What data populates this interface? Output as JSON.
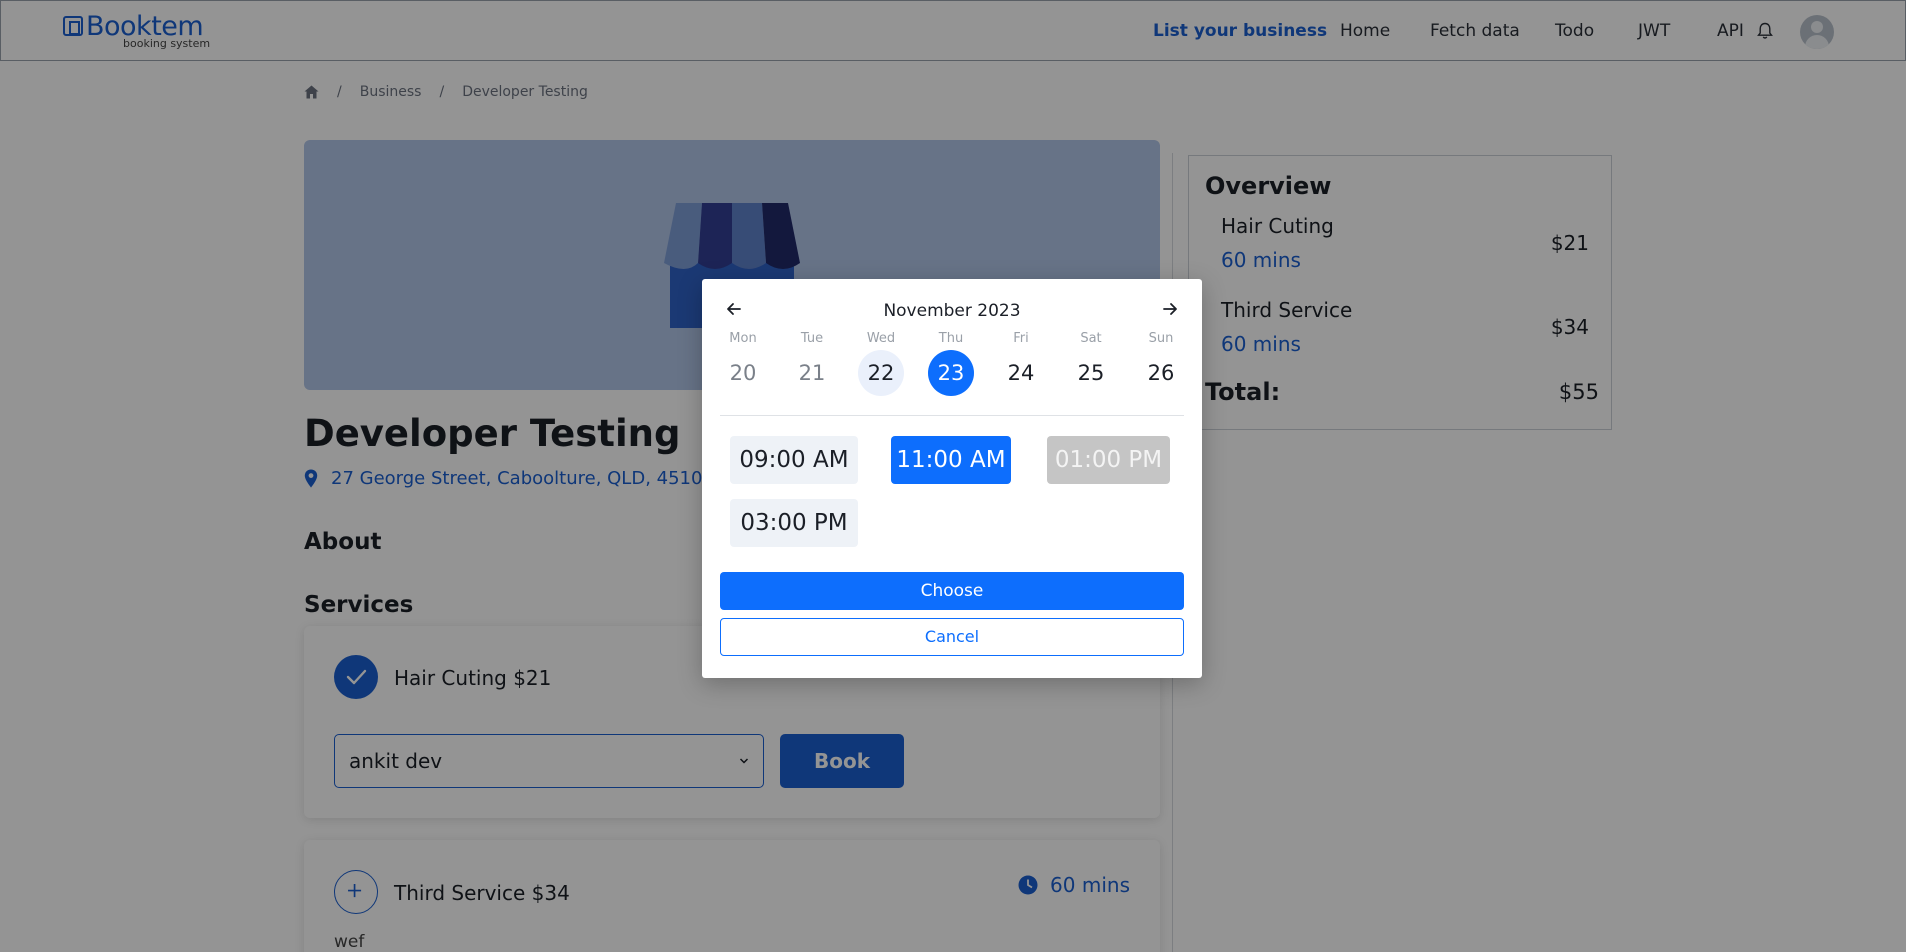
{
  "brand": {
    "name": "Booktem",
    "tagline": "booking system",
    "color": "#1a5fd1"
  },
  "nav": {
    "items": [
      "List your business",
      "Home",
      "Fetch data",
      "Todo",
      "JWT",
      "API"
    ]
  },
  "breadcrumb": [
    "Business",
    "Developer Testing"
  ],
  "business": {
    "title": "Developer Testing",
    "address": "27 George Street, Caboolture, QLD, 4510",
    "about_heading": "About",
    "services_heading": "Services"
  },
  "services": [
    {
      "label": "Hair Cuting $21",
      "staff": "ankit dev",
      "book_label": "Book",
      "selected": true
    },
    {
      "label": "Third Service $34",
      "duration": "60 mins",
      "description": "wef",
      "selected": false
    }
  ],
  "overview": {
    "title": "Overview",
    "items": [
      {
        "name": "Hair Cuting",
        "duration": "60 mins",
        "price": "$21"
      },
      {
        "name": "Third Service",
        "duration": "60 mins",
        "price": "$34"
      }
    ],
    "total_label": "Total:",
    "total_value": "$55"
  },
  "datepicker": {
    "month": "November 2023",
    "days": [
      {
        "dow": "Mon",
        "num": "20",
        "state": "past"
      },
      {
        "dow": "Tue",
        "num": "21",
        "state": "past"
      },
      {
        "dow": "Wed",
        "num": "22",
        "state": "today"
      },
      {
        "dow": "Thu",
        "num": "23",
        "state": "selected"
      },
      {
        "dow": "Fri",
        "num": "24",
        "state": "normal"
      },
      {
        "dow": "Sat",
        "num": "25",
        "state": "normal"
      },
      {
        "dow": "Sun",
        "num": "26",
        "state": "normal"
      }
    ],
    "slots": [
      {
        "time": "09:00 AM",
        "state": "available"
      },
      {
        "time": "11:00 AM",
        "state": "selected"
      },
      {
        "time": "01:00 PM",
        "state": "disabled"
      },
      {
        "time": "03:00 PM",
        "state": "available"
      }
    ],
    "choose_label": "Choose",
    "cancel_label": "Cancel"
  },
  "colors": {
    "primary": "#0d6efd",
    "accent": "#1a5fd1",
    "disabled_slot": "#c5c5c5"
  },
  "icons": [
    "home-icon",
    "map-pin-icon",
    "checkmark-icon",
    "plus-icon",
    "clock-icon",
    "chevron-down-icon",
    "arrow-left-icon",
    "arrow-right-icon",
    "bell-icon",
    "shop-icon"
  ]
}
